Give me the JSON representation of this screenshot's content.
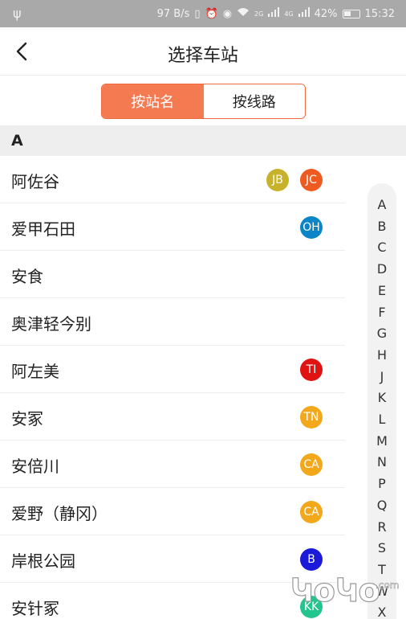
{
  "status_bar": {
    "speed": "97 B/s",
    "net1": "2G",
    "net2": "4G",
    "battery": "42%",
    "time": "15:32"
  },
  "header": {
    "title": "选择车站"
  },
  "segment": {
    "by_station": "按站名",
    "by_line": "按线路"
  },
  "section": {
    "letter": "A"
  },
  "stations": [
    {
      "name": "阿佐谷",
      "badges": [
        {
          "code": "JB",
          "color": "#c9b22b"
        },
        {
          "code": "JC",
          "color": "#ee5a1f"
        }
      ]
    },
    {
      "name": "爱甲石田",
      "badges": [
        {
          "code": "OH",
          "color": "#0b85c8"
        }
      ]
    },
    {
      "name": "安食",
      "badges": []
    },
    {
      "name": "奥津轻今别",
      "badges": []
    },
    {
      "name": "阿左美",
      "badges": [
        {
          "code": "TI",
          "color": "#e01313"
        }
      ]
    },
    {
      "name": "安冢",
      "badges": [
        {
          "code": "TN",
          "color": "#f2a81a"
        }
      ]
    },
    {
      "name": "安倍川",
      "badges": [
        {
          "code": "CA",
          "color": "#f2a81a"
        }
      ]
    },
    {
      "name": "爱野（静冈）",
      "badges": [
        {
          "code": "CA",
          "color": "#f2a81a"
        }
      ]
    },
    {
      "name": "岸根公园",
      "badges": [
        {
          "code": "B",
          "color": "#1a1ad8"
        }
      ]
    },
    {
      "name": "安针冢",
      "badges": [
        {
          "code": "KK",
          "color": "#22c58e"
        }
      ]
    }
  ],
  "index_letters": [
    "A",
    "B",
    "C",
    "D",
    "E",
    "F",
    "G",
    "H",
    "J",
    "K",
    "L",
    "M",
    "N",
    "P",
    "Q",
    "R",
    "S",
    "T",
    "W",
    "X"
  ],
  "colors": {
    "accent": "#f47a52",
    "status_bar_bg": "#a9a9a9"
  },
  "watermark": {
    "text": "ԿoԿo",
    "suffix": ".com"
  }
}
